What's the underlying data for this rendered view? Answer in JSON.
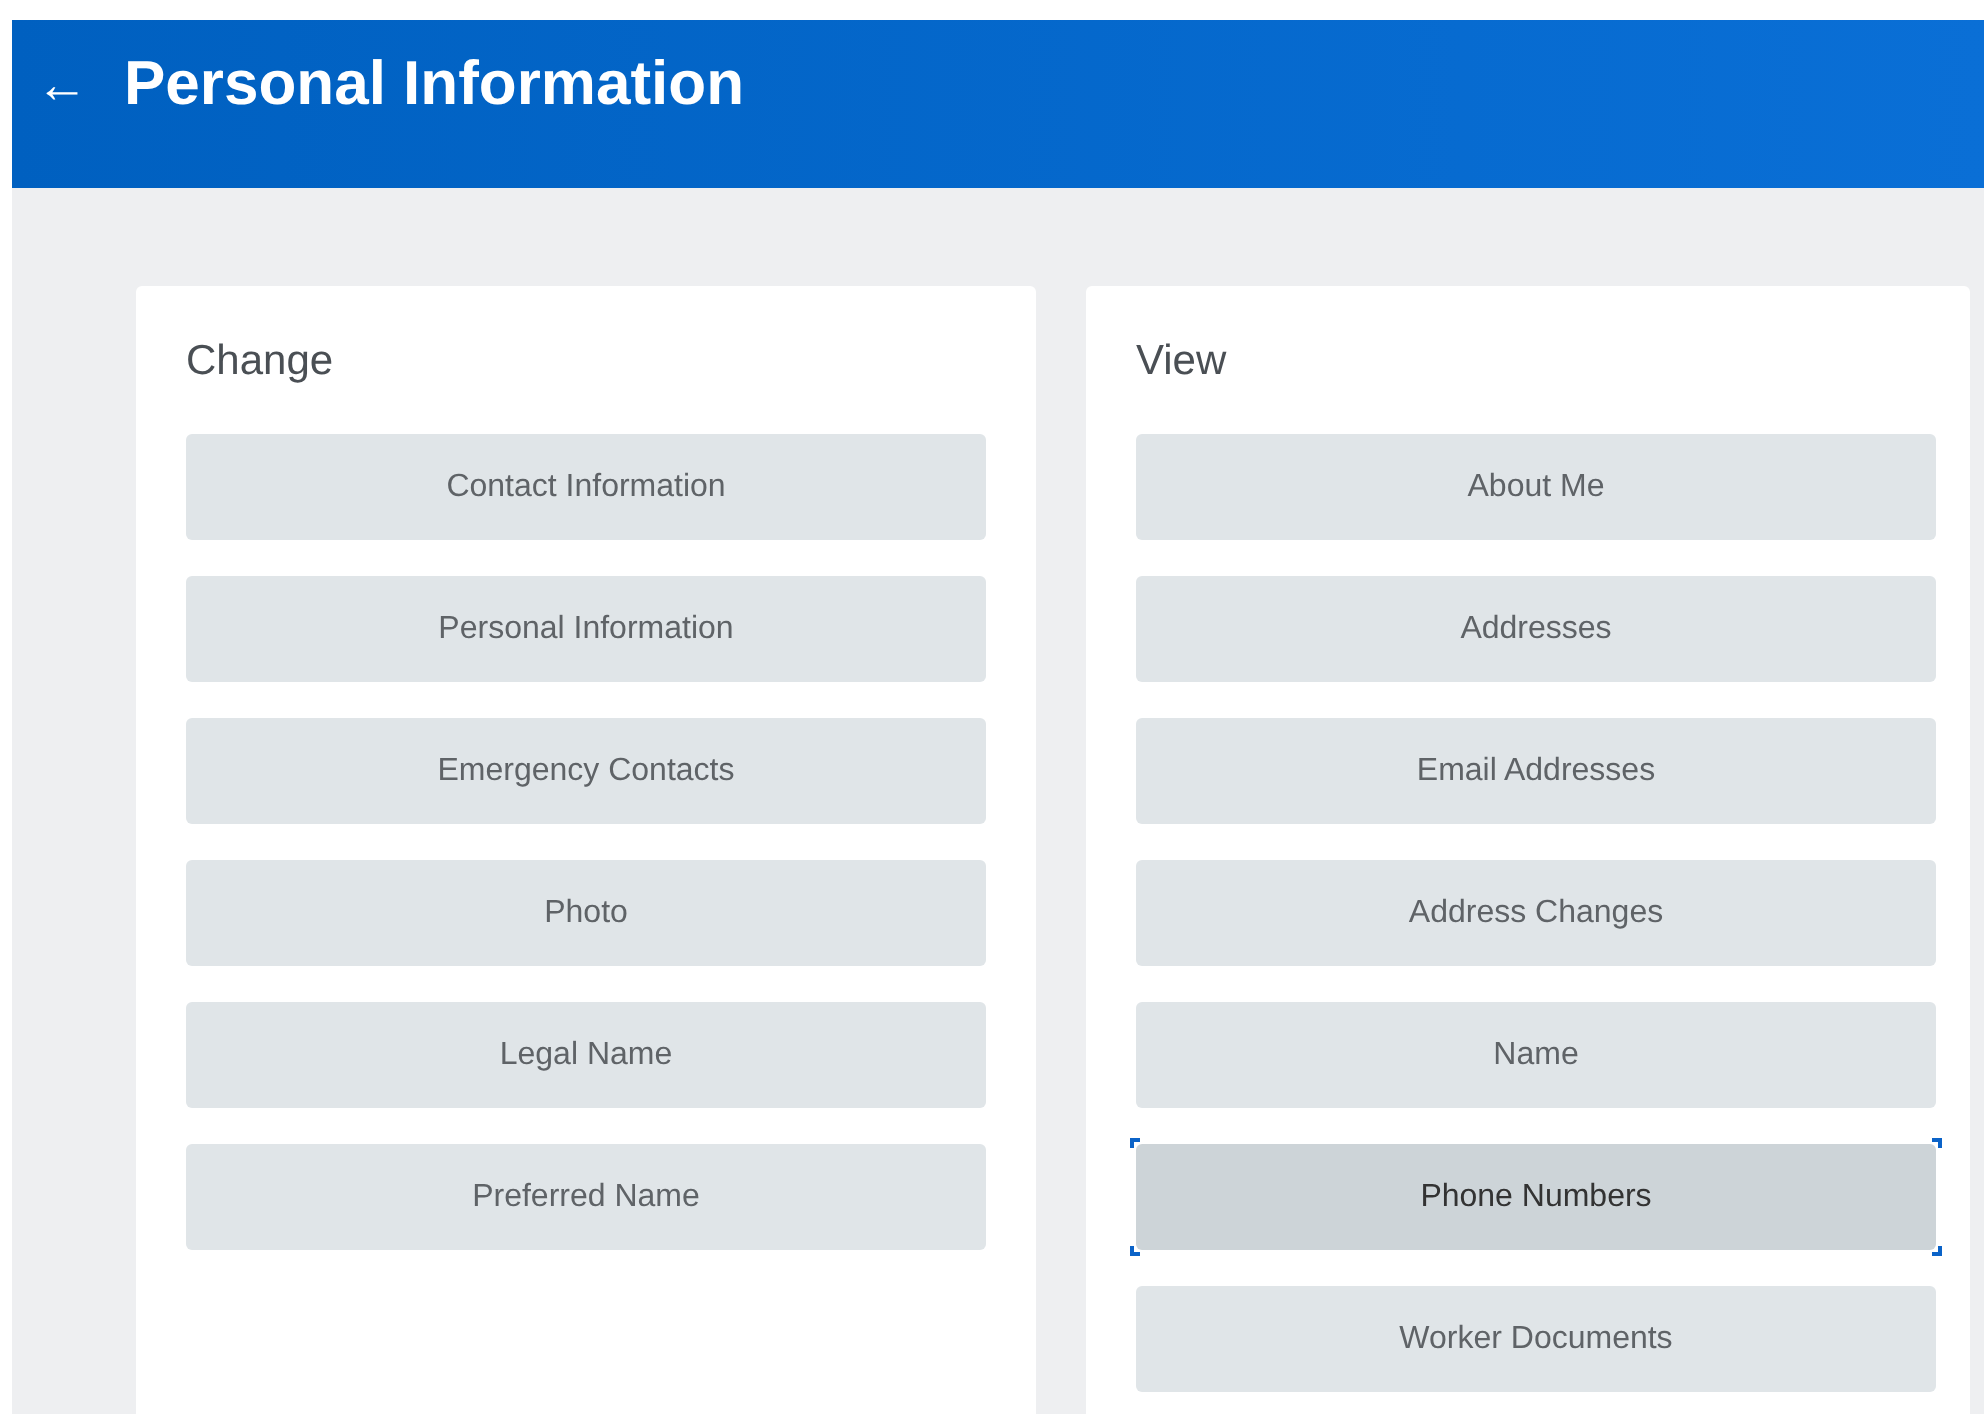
{
  "header": {
    "back_icon": "←",
    "title": "Personal Information"
  },
  "panels": [
    {
      "title": "Change",
      "buttons": [
        {
          "label": "Contact Information",
          "selected": false
        },
        {
          "label": "Personal Information",
          "selected": false
        },
        {
          "label": "Emergency Contacts",
          "selected": false
        },
        {
          "label": "Photo",
          "selected": false
        },
        {
          "label": "Legal Name",
          "selected": false
        },
        {
          "label": "Preferred Name",
          "selected": false
        }
      ]
    },
    {
      "title": "View",
      "buttons": [
        {
          "label": "About Me",
          "selected": false
        },
        {
          "label": "Addresses",
          "selected": false
        },
        {
          "label": "Email Addresses",
          "selected": false
        },
        {
          "label": "Address Changes",
          "selected": false
        },
        {
          "label": "Name",
          "selected": false
        },
        {
          "label": "Phone Numbers",
          "selected": true
        },
        {
          "label": "Worker Documents",
          "selected": false
        }
      ]
    }
  ]
}
